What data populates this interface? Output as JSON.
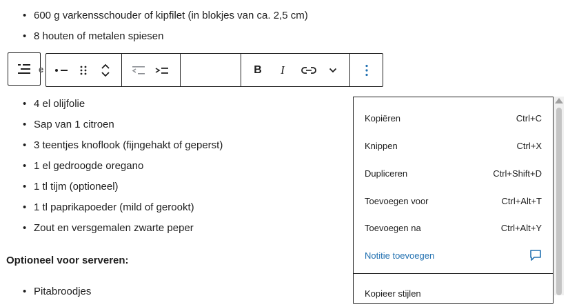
{
  "list_top": [
    "600 g varkensschouder of kipfilet (in blokjes van ca. 2,5 cm)",
    "8 houten of metalen spiesen"
  ],
  "list_main": [
    "4 el olijfolie",
    "Sap van 1 citroen",
    "3 teentjes knoflook (fijngehakt of geperst)",
    "1 el gedroogde oregano",
    "1 tl tijm (optioneel)",
    "1 tl paprikapoeder (mild of gerookt)",
    "Zout en versgemalen zwarte peper"
  ],
  "list_bottom": [
    "Pitabroodjes"
  ],
  "bullet": "•",
  "heading": "Optioneel voor serveren:",
  "toolbar": {
    "hidden_letter": "e",
    "bold_label": "B",
    "italic_label": "I"
  },
  "icons": {
    "block_type": "list-icon",
    "bullet_style": "unordered-list-icon",
    "drag": "drag-handle-icon",
    "move": "move-up-down-icon",
    "outdent": "outdent-icon",
    "indent": "indent-icon",
    "link": "link-icon",
    "more_formats": "chevron-down-icon",
    "options": "more-vertical-icon",
    "note": "comment-icon"
  },
  "menu": {
    "items": [
      {
        "label": "Kopiëren",
        "shortcut": "Ctrl+C"
      },
      {
        "label": "Knippen",
        "shortcut": "Ctrl+X"
      },
      {
        "label": "Dupliceren",
        "shortcut": "Ctrl+Shift+D"
      },
      {
        "label": "Toevoegen voor",
        "shortcut": "Ctrl+Alt+T"
      },
      {
        "label": "Toevoegen na",
        "shortcut": "Ctrl+Alt+Y"
      }
    ],
    "note_label": "Notitie toevoegen",
    "copy_styles_label": "Kopieer stijlen"
  },
  "colors": {
    "accent": "#2271b1",
    "text": "#1e1e1e",
    "muted": "#8c8f94"
  }
}
